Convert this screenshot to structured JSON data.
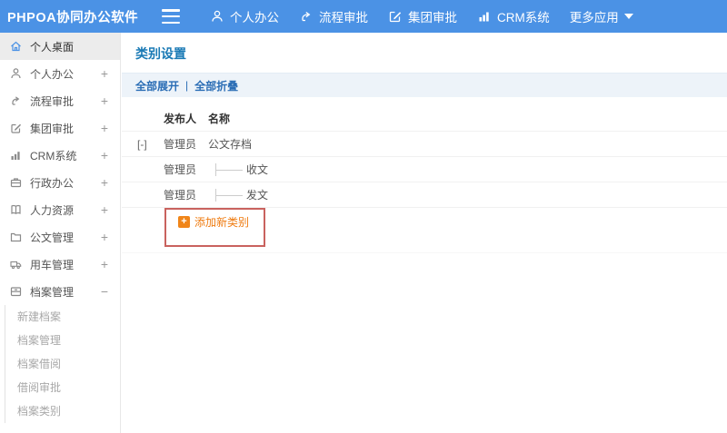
{
  "topbar": {
    "logo": "PHPOA协同办公软件",
    "nav": [
      {
        "label": "个人办公",
        "icon": "person-icon"
      },
      {
        "label": "流程审批",
        "icon": "flow-icon"
      },
      {
        "label": "集团审批",
        "icon": "edit-icon"
      },
      {
        "label": "CRM系统",
        "icon": "chart-icon"
      },
      {
        "label": "更多应用",
        "icon": "caret-down-icon"
      }
    ]
  },
  "sidebar": {
    "items": [
      {
        "label": "个人桌面",
        "icon": "home-icon",
        "expand": "",
        "active": true
      },
      {
        "label": "个人办公",
        "icon": "person-icon",
        "expand": "+"
      },
      {
        "label": "流程审批",
        "icon": "flow-icon",
        "expand": "+"
      },
      {
        "label": "集团审批",
        "icon": "edit-icon",
        "expand": "+"
      },
      {
        "label": "CRM系统",
        "icon": "chart-icon",
        "expand": "+"
      },
      {
        "label": "行政办公",
        "icon": "briefcase-icon",
        "expand": "+"
      },
      {
        "label": "人力资源",
        "icon": "book-icon",
        "expand": "+"
      },
      {
        "label": "公文管理",
        "icon": "folder-icon",
        "expand": "+"
      },
      {
        "label": "用车管理",
        "icon": "truck-icon",
        "expand": "+"
      },
      {
        "label": "档案管理",
        "icon": "archive-icon",
        "expand": "−"
      }
    ],
    "submenu": [
      "新建档案",
      "档案管理",
      "档案借阅",
      "借阅审批",
      "档案类别"
    ]
  },
  "main": {
    "title": "类别设置",
    "toolbar": {
      "expand_all": "全部展开",
      "separator": "|",
      "collapse_all": "全部折叠"
    },
    "table": {
      "headers": {
        "publisher": "发布人",
        "name": "名称"
      },
      "rows": [
        {
          "expander": "[-]",
          "publisher": "管理员",
          "name": "公文存档",
          "child": false
        },
        {
          "expander": "",
          "publisher": "管理员",
          "name": "收文",
          "child": true
        },
        {
          "expander": "",
          "publisher": "管理员",
          "name": "发文",
          "child": true
        }
      ]
    },
    "add_button": {
      "label": "添加新类别",
      "plus": "+"
    }
  },
  "colors": {
    "topbar_blue": "#4b92e5",
    "title_blue": "#1a7ab5",
    "toolbar_link_blue": "#2a6db5",
    "toolbar_bg": "#edf3f9",
    "active_item_bg": "#ececec",
    "add_orange": "#ef7b10",
    "highlight_red": "#c9625e"
  }
}
